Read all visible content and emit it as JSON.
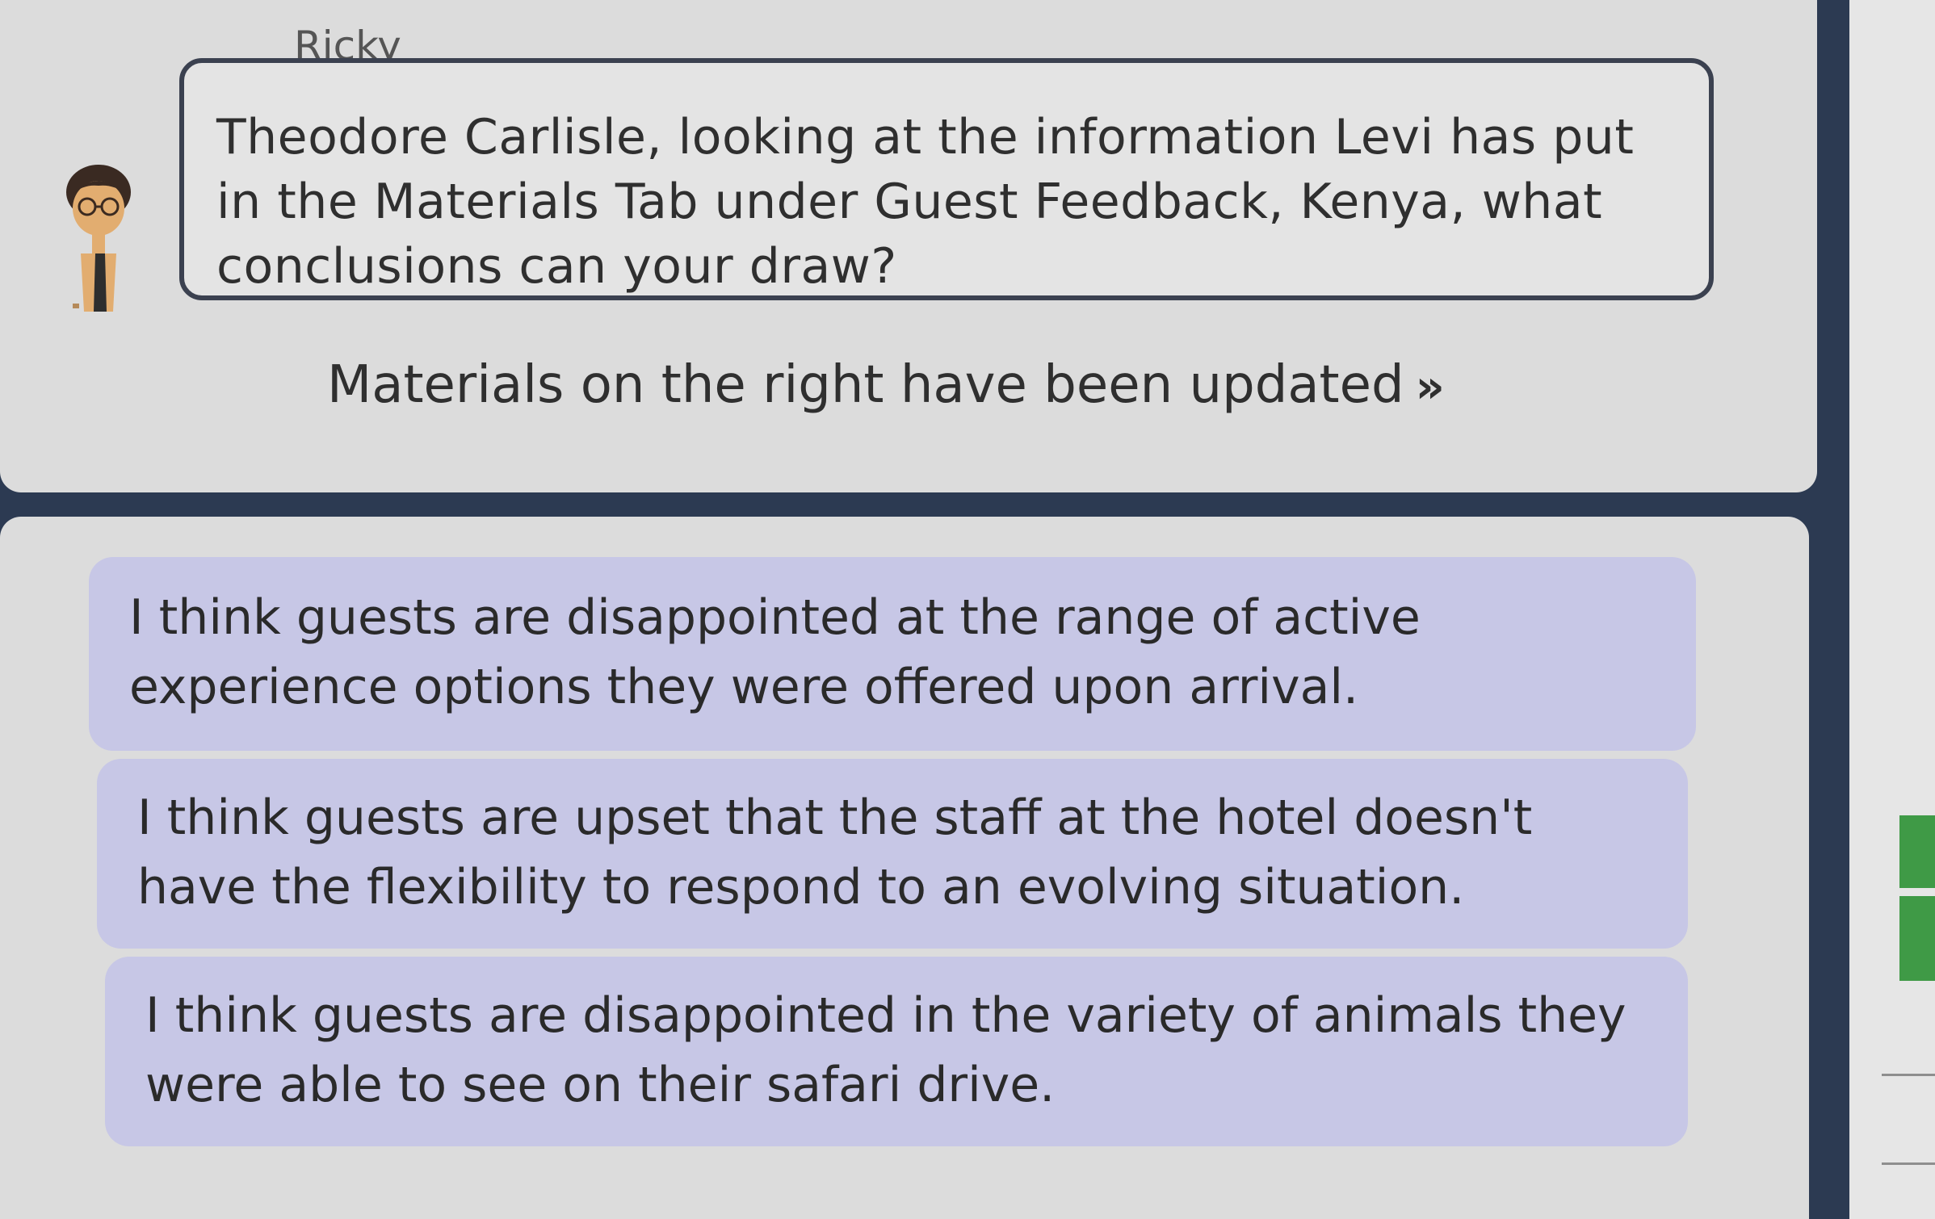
{
  "dialogue": {
    "speaker": "Ricky",
    "message": "Theodore Carlisle, looking at the information Levi has put in the Materials Tab under Guest Feedback, Kenya, what conclusions can your draw?",
    "materials_notice": "Materials on the right have been updated",
    "notice_arrows": "»"
  },
  "options": [
    {
      "text": "I think guests are disappointed at the range of active experience options they were offered upon arrival."
    },
    {
      "text": "I think guests are upset that the staff at the hotel doesn't have the flexibility to respond to an evolving situation."
    },
    {
      "text": "I think guests are disappointed in the variety of animals they were able to see on their safari drive."
    }
  ],
  "colors": {
    "option_bg": "#c7c7e6",
    "panel_bg": "#dcdcdc",
    "frame_bg": "#2c3a52",
    "accent_green": "#3f9a46"
  },
  "icons": {
    "avatar": "character-avatar-icon"
  }
}
